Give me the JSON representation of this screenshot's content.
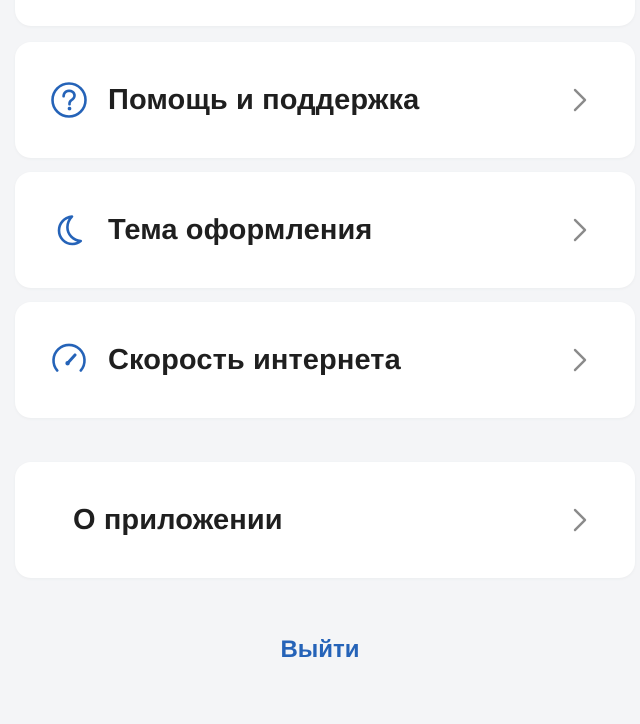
{
  "menu": {
    "items": [
      {
        "label": "Помощь и поддержка",
        "icon": "question-circle-icon"
      },
      {
        "label": "Тема оформления",
        "icon": "moon-icon"
      },
      {
        "label": "Скорость интернета",
        "icon": "speedometer-icon"
      },
      {
        "label": "О приложении",
        "icon": ""
      }
    ]
  },
  "logout": {
    "label": "Выйти"
  },
  "colors": {
    "accent": "#2563b8",
    "background": "#f4f5f7",
    "card": "#ffffff",
    "text": "#1f1f1f",
    "chevron": "#8a8a8a"
  }
}
